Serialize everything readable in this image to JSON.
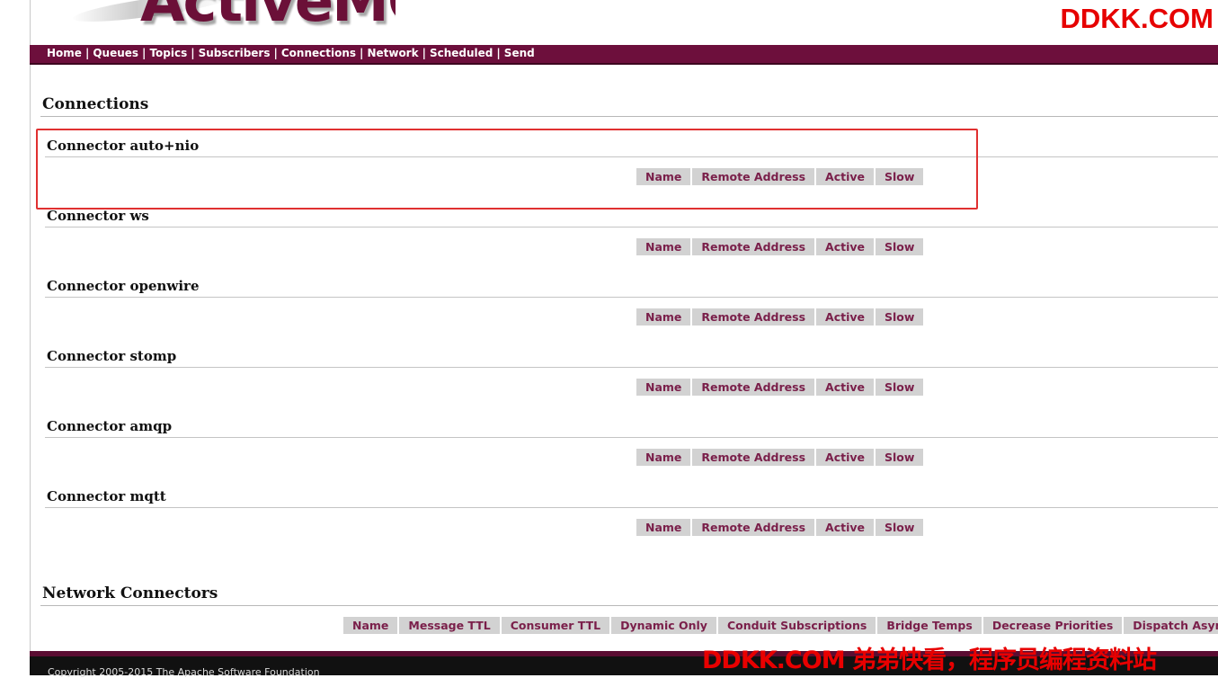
{
  "header": {
    "logo_text": "ActiveMQ",
    "brand": "DDKK.COM"
  },
  "nav": {
    "items": [
      "Home",
      "Queues",
      "Topics",
      "Subscribers",
      "Connections",
      "Network",
      "Scheduled",
      "Send"
    ]
  },
  "connections": {
    "title": "Connections",
    "connectors": [
      {
        "title": "Connector auto+nio"
      },
      {
        "title": "Connector ws"
      },
      {
        "title": "Connector openwire"
      },
      {
        "title": "Connector stomp"
      },
      {
        "title": "Connector amqp"
      },
      {
        "title": "Connector mqtt"
      }
    ],
    "columns": [
      "Name",
      "Remote Address",
      "Active",
      "Slow"
    ]
  },
  "network": {
    "title": "Network Connectors",
    "columns": [
      "Name",
      "Message TTL",
      "Consumer TTL",
      "Dynamic Only",
      "Conduit Subscriptions",
      "Bridge Temps",
      "Decrease Priorities",
      "Dispatch Async"
    ]
  },
  "footer": {
    "copyright": "Copyright 2005-2015 The Apache Software Foundation"
  },
  "watermark": "DDKK.COM 弟弟快看，程序员编程资料站",
  "colors": {
    "nav_bg": "#6d0f3c",
    "header_cell_bg": "#d2d2d2",
    "header_cell_text": "#7a1f4a",
    "highlight": "#e03030",
    "brand": "#e60000"
  }
}
